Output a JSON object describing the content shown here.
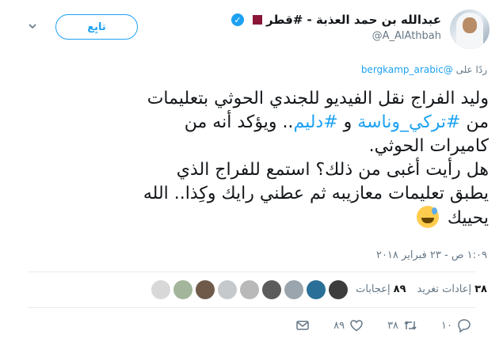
{
  "header": {
    "display_name": "عبدالله بن حمد العذبة - #قطر",
    "handle": "@A_AlAthbah",
    "follow_label": "تابِع"
  },
  "reply": {
    "prefix": "ردًا على",
    "to": "@bergkamp_arabic"
  },
  "tweet": {
    "line1": "وليد الفراج نقل الفيديو للجندي الحوثي بتعليمات",
    "line2_pre": "من ",
    "hashtag1": "#تركي_وناسة",
    "line2_mid": " و ",
    "hashtag2": "#دليم",
    "line2_post": ".. ويؤكد أنه من",
    "line3": "كاميرات الحوثي.",
    "line4": "هل رأيت أغبى من ذلك؟ استمع للفراج الذي",
    "line5": "يطبق تعليمات معازيبه ثم عطني رايك وكِذا.. الله",
    "line6": "يحييك",
    "emoji": "grinning-sweat-emoji"
  },
  "timestamp": "١:٠٩ ص - ٢٣ فبراير ٢٠١٨",
  "stats": {
    "retweets_count": "٣٨",
    "retweets_label": "إعادات تغريد",
    "likes_count": "٨٩",
    "likes_label": "إعجابات"
  },
  "actions": {
    "reply_count": "١٠",
    "retweet_count": "٣٨",
    "like_count": "٨٩"
  },
  "colors": {
    "accent": "#1da1f2",
    "muted": "#657786",
    "text": "#14171a"
  }
}
